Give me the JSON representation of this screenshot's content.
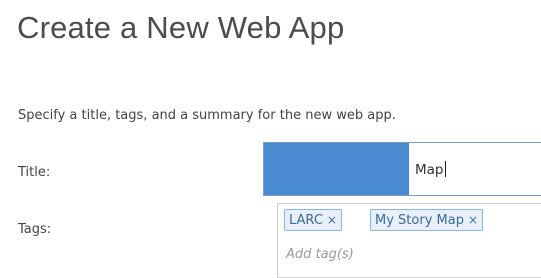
{
  "page": {
    "title": "Create a New Web App"
  },
  "form": {
    "intro": "Specify a title, tags, and a summary for the new web app.",
    "title_label": "Title:",
    "title_value": "Map",
    "tags_label": "Tags:",
    "tags": [
      {
        "label": "LARC",
        "remove": "×"
      },
      {
        "label": "My Story Map",
        "remove": "×"
      }
    ],
    "add_tag_placeholder": "Add tag(s)"
  },
  "colors": {
    "redaction": "#4a8ad1",
    "chip_bg": "#e7f0f8",
    "chip_border": "#8fb6d8"
  }
}
